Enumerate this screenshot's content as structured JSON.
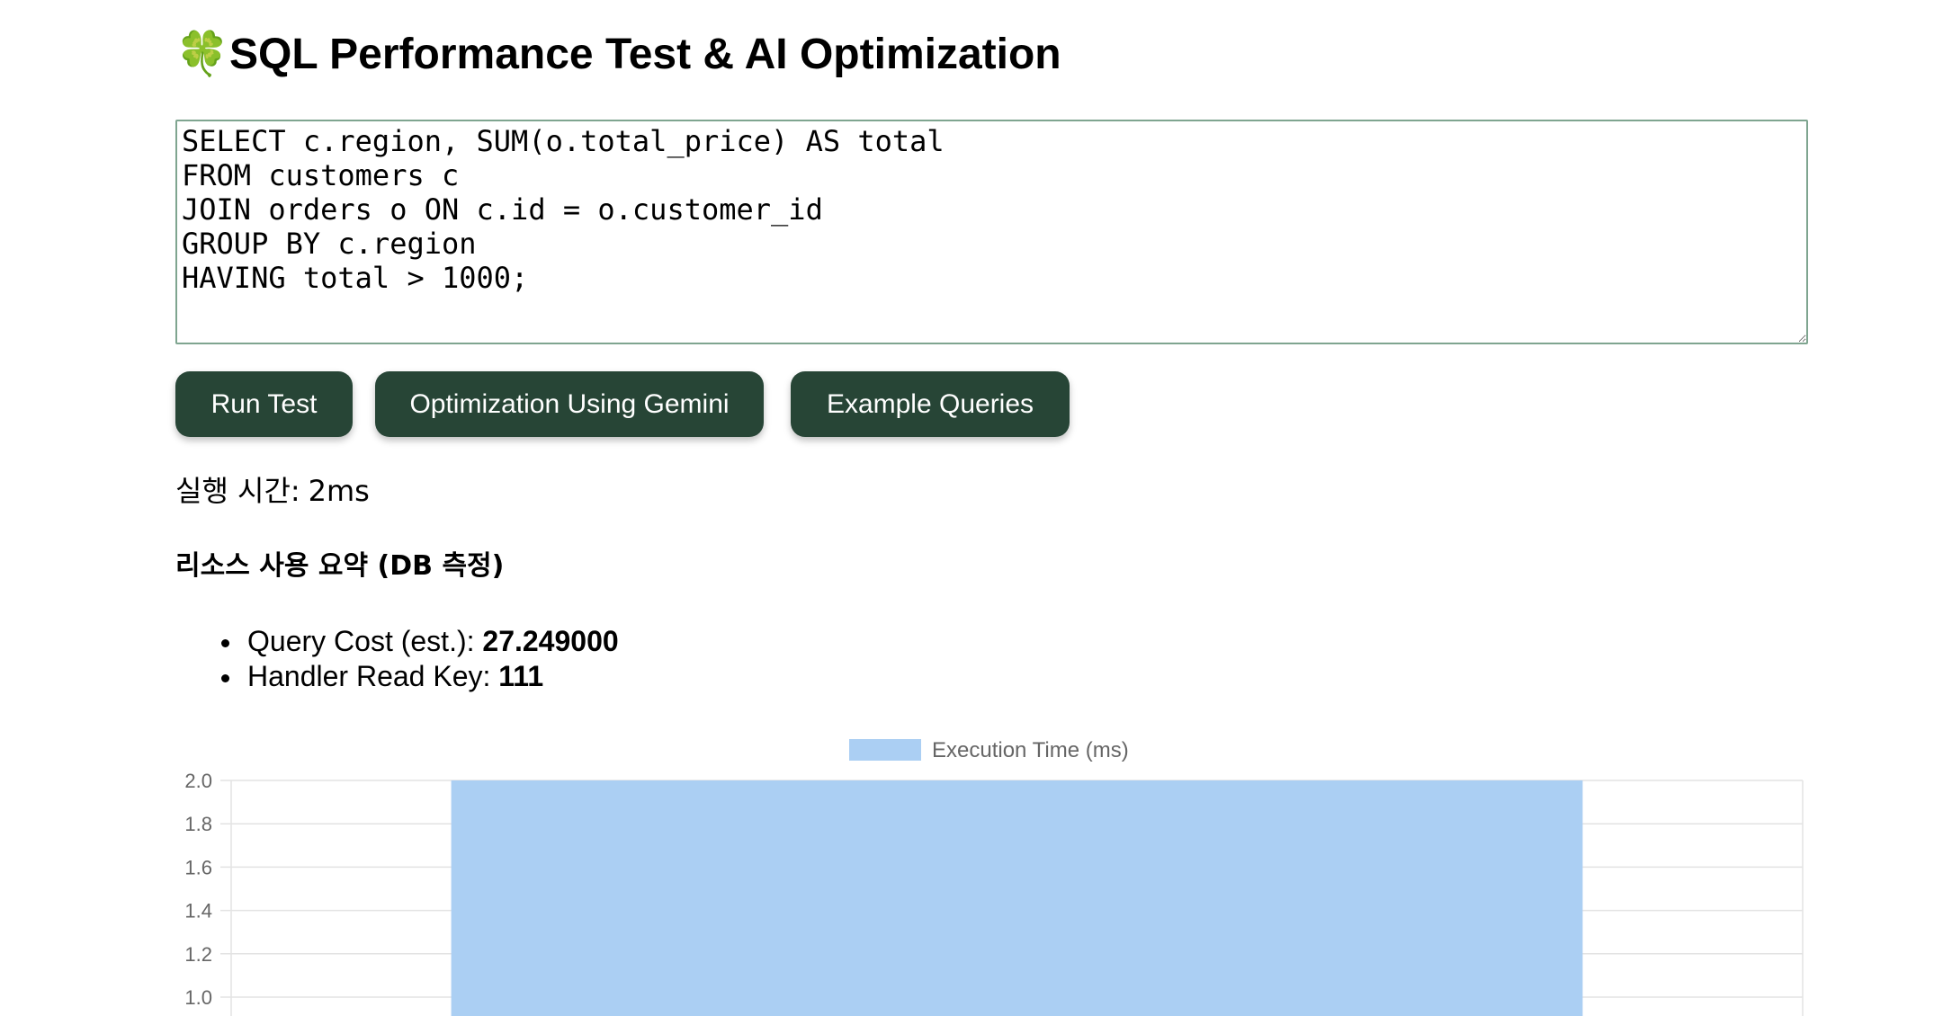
{
  "header": {
    "icon": "four-leaf-clover-icon",
    "icon_glyph": "🍀",
    "title": "SQL Performance Test & AI Optimization"
  },
  "editor": {
    "value": "SELECT c.region, SUM(o.total_price) AS total\nFROM customers c\nJOIN orders o ON c.id = o.customer_id\nGROUP BY c.region\nHAVING total > 1000;"
  },
  "buttons": {
    "run": "Run Test",
    "optimize": "Optimization Using Gemini",
    "examples": "Example Queries"
  },
  "result": {
    "exec_label": "실행 시간:",
    "exec_value": "2ms",
    "summary_title": "리소스 사용 요약 (DB 측정)",
    "metrics": [
      {
        "label": "Query Cost (est.):",
        "value": "27.249000"
      },
      {
        "label": "Handler Read Key:",
        "value": "111"
      }
    ]
  },
  "colors": {
    "button_bg": "#274536",
    "editor_border": "#7fa590",
    "bar_fill": "#abcff3",
    "grid": "#e3e3e3",
    "tick_text": "#666666"
  },
  "chart_data": {
    "type": "bar",
    "series": [
      {
        "name": "Execution Time (ms)",
        "values": [
          2
        ]
      }
    ],
    "categories": [
      ""
    ],
    "yticks": [
      "2.0",
      "1.8",
      "1.6",
      "1.4",
      "1.2",
      "1.0"
    ],
    "ylim": [
      0,
      2
    ],
    "grid": true,
    "legend": "top-center"
  }
}
